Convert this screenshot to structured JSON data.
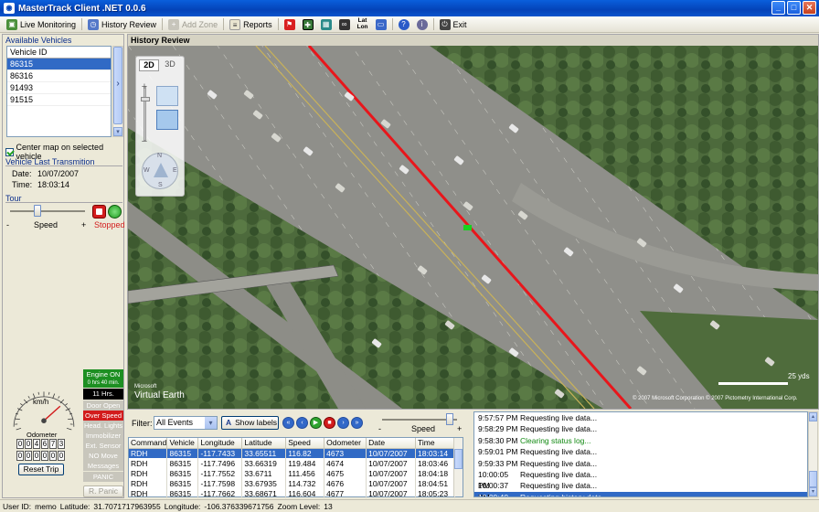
{
  "window": {
    "title": "MasterTrack Client .NET 0.0.6",
    "app_icon": "globe-icon",
    "minimize": "_",
    "maximize": "□",
    "close": "✕"
  },
  "toolbar": {
    "live_monitoring": "Live Monitoring",
    "history_review": "History Review",
    "add_zone": "Add Zone",
    "reports": "Reports",
    "latlon_top": "Lat",
    "latlon_bottom": "Lon",
    "exit": "Exit"
  },
  "left": {
    "available_vehicles": "Available Vehicles",
    "vehicle_header": "Vehicle ID",
    "vehicles": [
      "86315",
      "86316",
      "91493",
      "91515"
    ],
    "selected_vehicle": "86315",
    "scroll_right": "›",
    "center_map": "Center map on selected vehicle",
    "last_transmission": "Vehicle Last Transmition",
    "date_label": "Date:",
    "date_value": "10/07/2007",
    "time_label": "Time:",
    "time_value": "18:03:14",
    "tour": "Tour",
    "speed_minus": "-",
    "speed_label": "Speed",
    "speed_plus": "+",
    "stopped": "Stopped",
    "gauge_unit": "km/h",
    "odometer_label": "Odometer",
    "odometer_top": [
      "0",
      "0",
      "4",
      "6",
      "7",
      "3"
    ],
    "odometer_bottom": [
      "0",
      "0",
      "0",
      "0",
      "0",
      "0"
    ],
    "reset_trip": "Reset Trip",
    "engine_on": "Engine ON",
    "engine_time": "0 hrs 40 min.",
    "hours": "11 Hrs.",
    "door_open": "Door Open",
    "over_speed": "Over Speed",
    "head_lights": "Head. Lights",
    "immobilizer": "Immobilizer",
    "ext_sensor": "Ext. Sensor",
    "no_move": "NO Move",
    "messages": "Messages",
    "panic": "PANIC",
    "r_panic": "R. Panic"
  },
  "map": {
    "header": "History Review",
    "mode_2d": "2D",
    "mode_3d": "3D",
    "logo_small": "Microsoft",
    "logo": "Virtual Earth",
    "scale": "25 yds",
    "copyright": "© 2007 Microsoft Corporation  © 2007 Pictometry International Corp.",
    "compass_n": "N",
    "compass_w": "W",
    "compass_e": "E",
    "compass_s": "S",
    "route_color": "#e8161b",
    "vehicle_color": "#19d11f"
  },
  "bottom": {
    "filter_label": "Filter:",
    "filter_value": "All Events",
    "show_labels": "Show labels",
    "speed_label": "Speed",
    "speed_minus": "-",
    "speed_plus": "+",
    "columns": [
      "Command",
      "Vehicle",
      "Longitude",
      "Latitude",
      "Speed",
      "Odometer",
      "Date",
      "Time"
    ],
    "rows": [
      [
        "RDH",
        "86315",
        "-117.7433",
        "33.65511",
        "116.82",
        "4673",
        "10/07/2007",
        "18:03:14"
      ],
      [
        "RDH",
        "86315",
        "-117.7496",
        "33.66319",
        "119.484",
        "4674",
        "10/07/2007",
        "18:03:46"
      ],
      [
        "RDH",
        "86315",
        "-117.7552",
        "33.6711",
        "111.456",
        "4675",
        "10/07/2007",
        "18:04:18"
      ],
      [
        "RDH",
        "86315",
        "-117.7598",
        "33.67935",
        "114.732",
        "4676",
        "10/07/2007",
        "18:04:51"
      ],
      [
        "RDH",
        "86315",
        "-117.7662",
        "33.68671",
        "116.604",
        "4677",
        "10/07/2007",
        "18:05:23"
      ]
    ],
    "highlight_row": 0
  },
  "log": {
    "entries": [
      {
        "time": "9:57:57 PM",
        "msg": "Requesting live data...",
        "color": "#000000"
      },
      {
        "time": "9:58:29 PM",
        "msg": "Requesting live data...",
        "color": "#000000"
      },
      {
        "time": "9:58:30 PM",
        "msg": "Clearing status log...",
        "color": "#138a13"
      },
      {
        "time": "9:59:01 PM",
        "msg": "Requesting live data...",
        "color": "#000000"
      },
      {
        "time": "9:59:33 PM",
        "msg": "Requesting live data...",
        "color": "#000000"
      },
      {
        "time": "10:00:05 PM",
        "msg": "Requesting live data...",
        "color": "#000000"
      },
      {
        "time": "10:00:37 PM",
        "msg": "Requesting live data...",
        "color": "#000000"
      },
      {
        "time": "10:00:40 PM",
        "msg": "Requesting history data ...",
        "color": "#ffffff"
      }
    ],
    "selected": 7
  },
  "status": {
    "user_label": "User ID:",
    "user": "memo",
    "lat_label": "Latitude:",
    "lat": "31.7071717963955",
    "lon_label": "Longitude:",
    "lon": "-106.376339671756",
    "zoom_label": "Zoom Level:",
    "zoom": "13"
  }
}
